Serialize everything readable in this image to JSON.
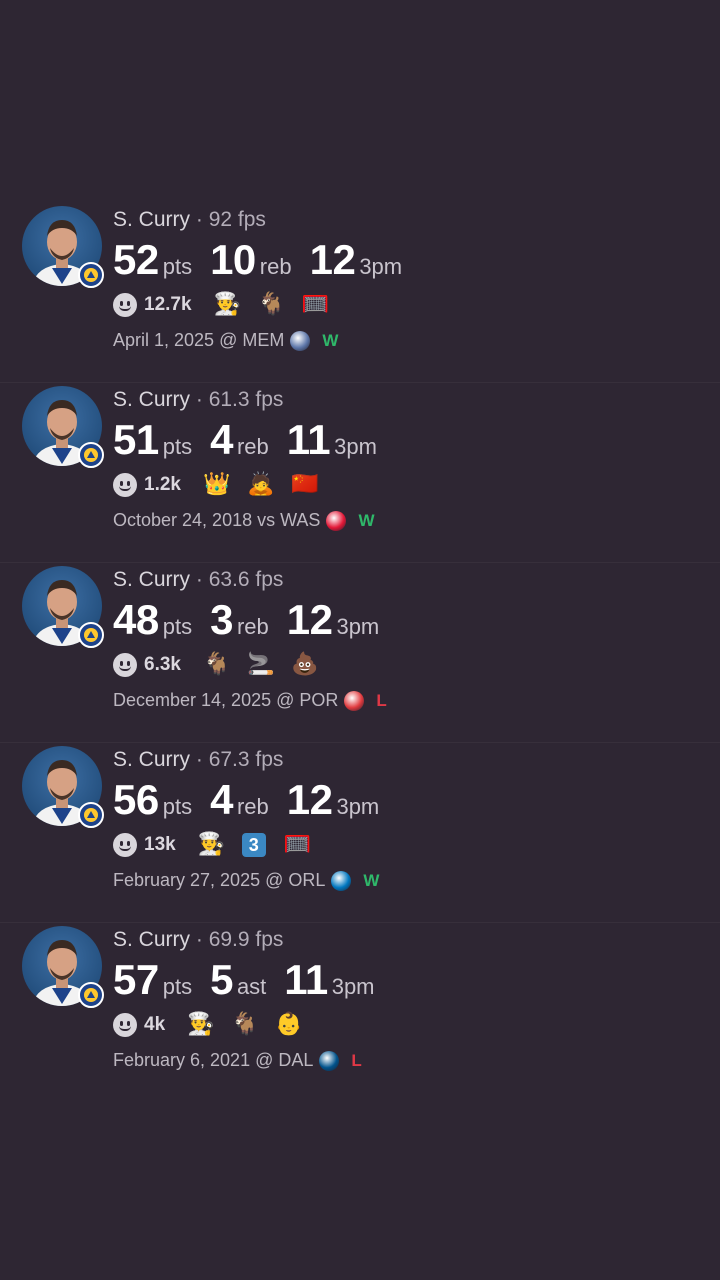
{
  "colors": {
    "background": "#2e2633",
    "win": "#2fb86a",
    "loss": "#e03846"
  },
  "games": [
    {
      "player": "S. Curry",
      "sep": " · ",
      "fps": "92 fps",
      "stats": [
        {
          "value": "52",
          "unit": "pts"
        },
        {
          "value": "10",
          "unit": "reb"
        },
        {
          "value": "12",
          "unit": "3pm"
        }
      ],
      "reactions": "12.7k",
      "emojis": [
        "chef-icon",
        "goat-icon",
        "basketball-hoop-icon"
      ],
      "emoji_glyphs": [
        "👨‍🍳",
        "🐐",
        "🥅"
      ],
      "date_line": "April 1, 2025 @ MEM",
      "opponent_logo": "grizzlies-logo-icon",
      "opponent_color": "#5d76a9",
      "result": "W"
    },
    {
      "player": "S. Curry",
      "sep": " · ",
      "fps": "61.3 fps",
      "stats": [
        {
          "value": "51",
          "unit": "pts"
        },
        {
          "value": "4",
          "unit": "reb"
        },
        {
          "value": "11",
          "unit": "3pm"
        }
      ],
      "reactions": "1.2k",
      "emojis": [
        "crown-icon",
        "person-bowing-icon",
        "china-flag-icon"
      ],
      "emoji_glyphs": [
        "👑",
        "🙇",
        "🇨🇳"
      ],
      "date_line": "October 24, 2018 vs WAS",
      "opponent_logo": "wizards-logo-icon",
      "opponent_color": "#e31837",
      "result": "W"
    },
    {
      "player": "S. Curry",
      "sep": " · ",
      "fps": "63.6 fps",
      "stats": [
        {
          "value": "48",
          "unit": "pts"
        },
        {
          "value": "3",
          "unit": "reb"
        },
        {
          "value": "12",
          "unit": "3pm"
        }
      ],
      "reactions": "6.3k",
      "emojis": [
        "goat-icon",
        "smoking-icon",
        "poop-icon"
      ],
      "emoji_glyphs": [
        "🐐",
        "🚬",
        "💩"
      ],
      "date_line": "December 14, 2025 @ POR",
      "opponent_logo": "blazers-logo-icon",
      "opponent_color": "#e03a3e",
      "result": "L"
    },
    {
      "player": "S. Curry",
      "sep": " · ",
      "fps": "67.3 fps",
      "stats": [
        {
          "value": "56",
          "unit": "pts"
        },
        {
          "value": "4",
          "unit": "reb"
        },
        {
          "value": "12",
          "unit": "3pm"
        }
      ],
      "reactions": "13k",
      "emojis": [
        "chef-icon",
        "keycap-three-icon",
        "basketball-hoop-icon"
      ],
      "emoji_glyphs": [
        "👨‍🍳",
        "3",
        "🥅"
      ],
      "date_line": "February 27, 2025 @ ORL",
      "opponent_logo": "magic-logo-icon",
      "opponent_color": "#0077c0",
      "result": "W"
    },
    {
      "player": "S. Curry",
      "sep": " · ",
      "fps": "69.9 fps",
      "stats": [
        {
          "value": "57",
          "unit": "pts"
        },
        {
          "value": "5",
          "unit": "ast"
        },
        {
          "value": "11",
          "unit": "3pm"
        }
      ],
      "reactions": "4k",
      "emojis": [
        "chef-icon",
        "goat-icon",
        "baby-icon"
      ],
      "emoji_glyphs": [
        "👨‍🍳",
        "🐐",
        "👶"
      ],
      "date_line": "February 6, 2021 @ DAL",
      "opponent_logo": "mavericks-logo-icon",
      "opponent_color": "#00538c",
      "result": "L"
    }
  ]
}
